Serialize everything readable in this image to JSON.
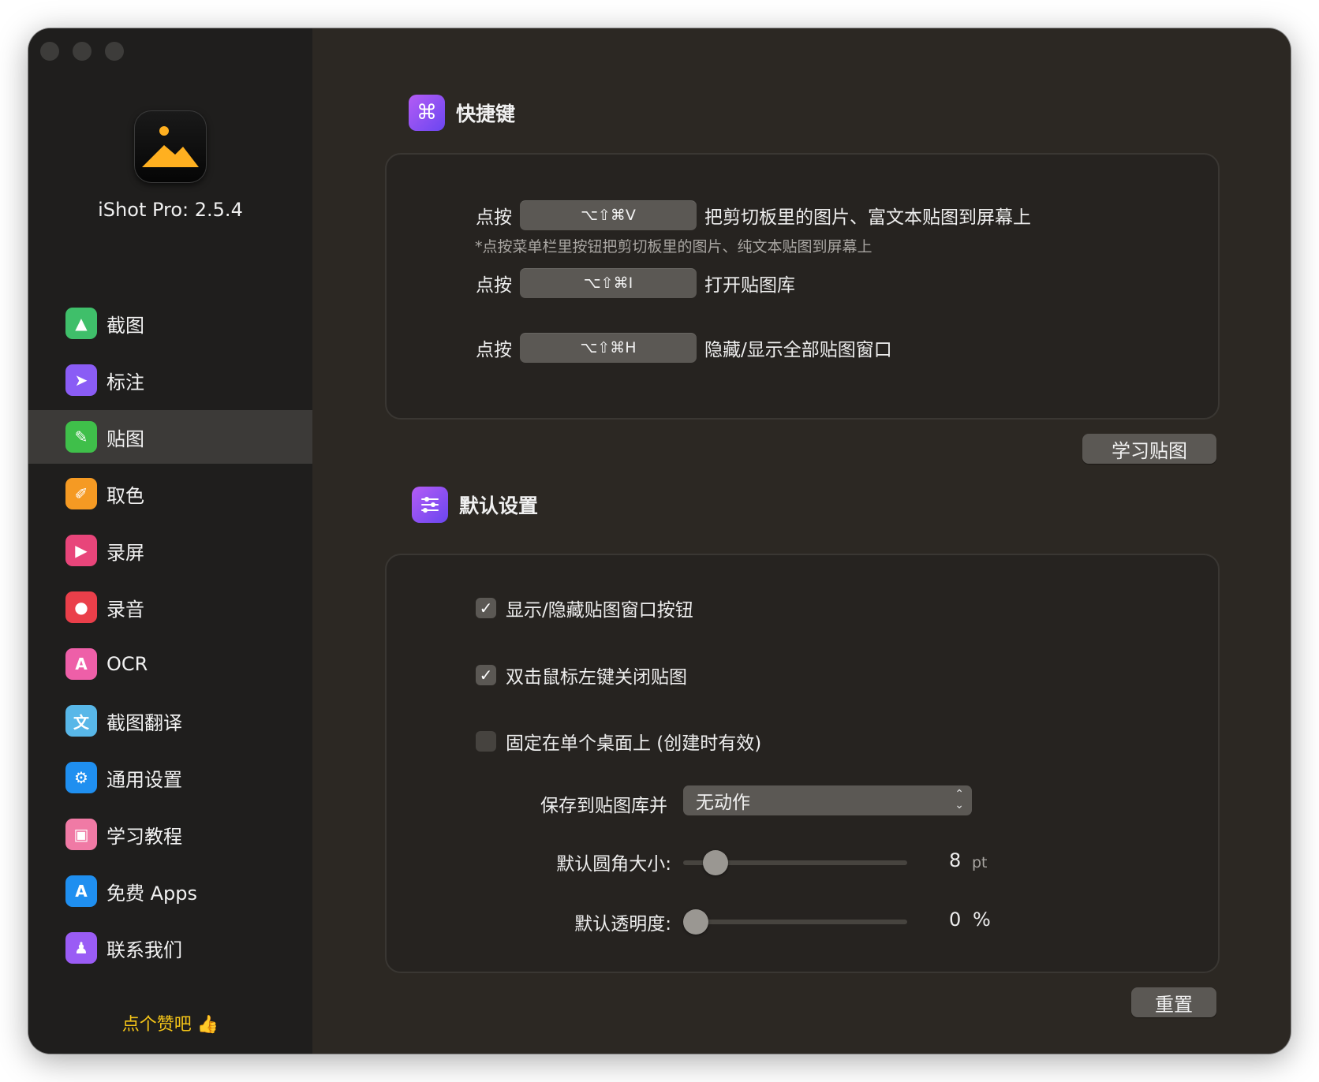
{
  "app": {
    "version_label": "iShot Pro: 2.5.4"
  },
  "sidebar": {
    "items": [
      {
        "label": "截图",
        "icon": "image-icon",
        "color": "#3fbf6a"
      },
      {
        "label": "标注",
        "icon": "cursor-icon",
        "color": "#8a5cf5"
      },
      {
        "label": "贴图",
        "icon": "pin-icon",
        "color": "#3fbf4a",
        "active": true
      },
      {
        "label": "取色",
        "icon": "eyedropper-icon",
        "color": "#f59a23"
      },
      {
        "label": "录屏",
        "icon": "video-icon",
        "color": "#e8457a"
      },
      {
        "label": "录音",
        "icon": "microphone-icon",
        "color": "#ea3f4a"
      },
      {
        "label": "OCR",
        "icon": "ocr-icon",
        "color": "#ee5fa8"
      },
      {
        "label": "截图翻译",
        "icon": "translate-icon",
        "color": "#58b7e8"
      },
      {
        "label": "通用设置",
        "icon": "gear-icon",
        "color": "#1f8ff0"
      },
      {
        "label": "学习教程",
        "icon": "film-icon",
        "color": "#f07aa5"
      },
      {
        "label": "免费 Apps",
        "icon": "appstore-icon",
        "color": "#1f8ff0"
      },
      {
        "label": "联系我们",
        "icon": "people-icon",
        "color": "#9a5cf5"
      }
    ],
    "like_label": "点个赞吧 👍"
  },
  "shortcuts": {
    "title": "快捷键",
    "rows": [
      {
        "prefix": "点按",
        "keys": "⌥⇧⌘V",
        "desc": "把剪切板里的图片、富文本贴图到屏幕上"
      },
      {
        "prefix": "点按",
        "keys": "⌥⇧⌘I",
        "desc": "打开贴图库"
      },
      {
        "prefix": "点按",
        "keys": "⌥⇧⌘H",
        "desc": "隐藏/显示全部贴图窗口"
      }
    ],
    "hint": "*点按菜单栏里按钮把剪切板里的图片、纯文本贴图到屏幕上",
    "learn_button": "学习贴图"
  },
  "defaults": {
    "title": "默认设置",
    "checks": [
      {
        "label": "显示/隐藏贴图窗口按钮",
        "checked": true
      },
      {
        "label": "双击鼠标左键关闭贴图",
        "checked": true
      },
      {
        "label": "固定在单个桌面上 (创建时有效)",
        "checked": false
      }
    ],
    "save_label": "保存到贴图库并",
    "save_value": "无动作",
    "corner_label": "默认圆角大小:",
    "corner_value": "8",
    "corner_unit": "pt",
    "corner_fraction": 0.1,
    "opacity_label": "默认透明度:",
    "opacity_value": "0",
    "opacity_unit": "%",
    "opacity_fraction": 0.0,
    "reset_button": "重置"
  }
}
